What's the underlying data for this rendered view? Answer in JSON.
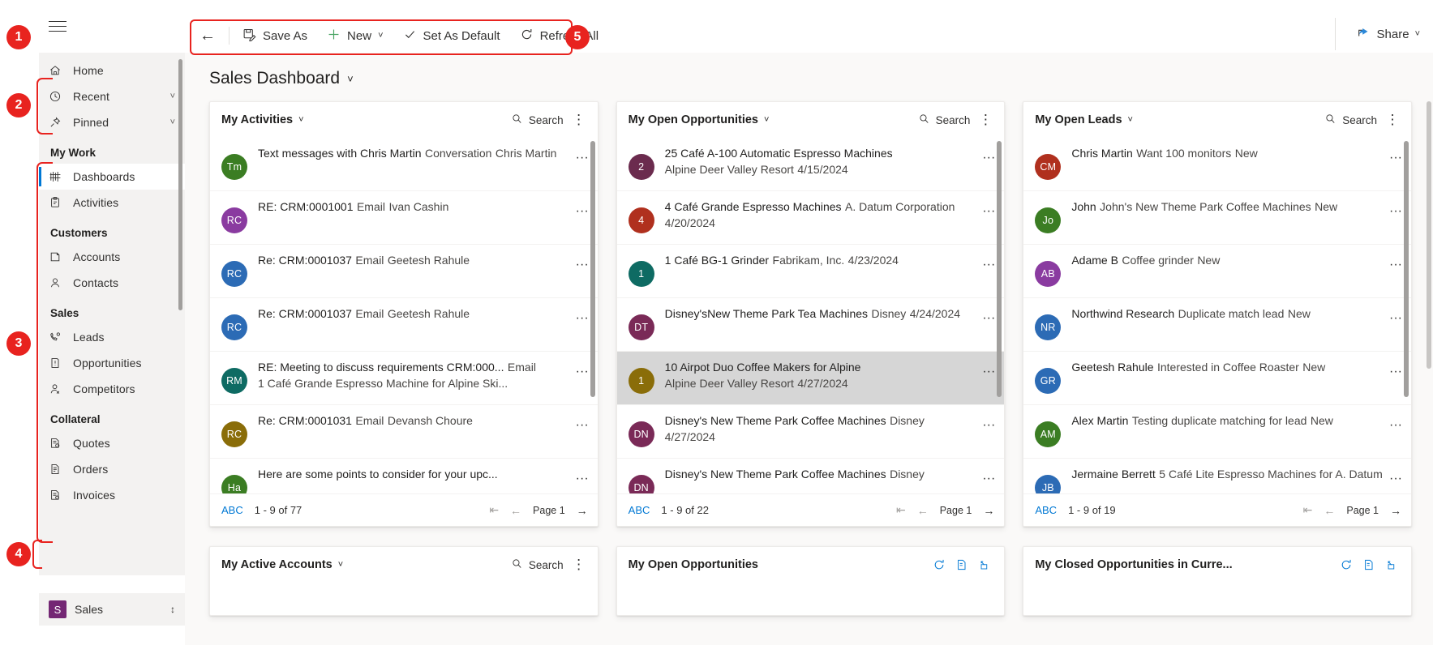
{
  "topbar": {
    "hamburger_label": "Site map",
    "back_label": "Back",
    "buttons": [
      {
        "id": "save-as",
        "label": "Save As",
        "icon": "save-as-icon"
      },
      {
        "id": "new",
        "label": "New",
        "icon": "plus-icon",
        "has_chevron": true
      },
      {
        "id": "set-as-default",
        "label": "Set As Default",
        "icon": "check-icon"
      },
      {
        "id": "refresh-all",
        "label": "Refresh All",
        "icon": "refresh-icon"
      }
    ],
    "share": {
      "label": "Share",
      "icon": "share-icon",
      "has_chevron": true
    }
  },
  "sidebar": {
    "items": [
      {
        "id": "home",
        "label": "Home",
        "icon": "home-icon",
        "expandable": false
      },
      {
        "id": "recent",
        "label": "Recent",
        "icon": "clock-icon",
        "expandable": true
      },
      {
        "id": "pinned",
        "label": "Pinned",
        "icon": "pin-icon",
        "expandable": true
      }
    ],
    "groups": [
      {
        "title": "My Work",
        "items": [
          {
            "id": "dashboards",
            "label": "Dashboards",
            "icon": "dashboard-icon",
            "selected": true
          },
          {
            "id": "activities",
            "label": "Activities",
            "icon": "activities-icon",
            "selected": false
          }
        ]
      },
      {
        "title": "Customers",
        "items": [
          {
            "id": "accounts",
            "label": "Accounts",
            "icon": "accounts-icon",
            "selected": false
          },
          {
            "id": "contacts",
            "label": "Contacts",
            "icon": "contact-icon",
            "selected": false
          }
        ]
      },
      {
        "title": "Sales",
        "items": [
          {
            "id": "leads",
            "label": "Leads",
            "icon": "leads-icon",
            "selected": false
          },
          {
            "id": "opportunities",
            "label": "Opportunities",
            "icon": "opportunity-icon",
            "selected": false
          },
          {
            "id": "competitors",
            "label": "Competitors",
            "icon": "competitor-icon",
            "selected": false
          }
        ]
      },
      {
        "title": "Collateral",
        "items": [
          {
            "id": "quotes",
            "label": "Quotes",
            "icon": "quote-icon",
            "selected": false
          },
          {
            "id": "orders",
            "label": "Orders",
            "icon": "order-icon",
            "selected": false
          },
          {
            "id": "invoices",
            "label": "Invoices",
            "icon": "invoice-icon",
            "selected": false
          }
        ]
      }
    ],
    "app_switcher": {
      "initial": "S",
      "label": "Sales",
      "icon": "updown-chevron-icon"
    }
  },
  "dashboard": {
    "title": "Sales Dashboard",
    "title_chevron": "chevron-down-icon"
  },
  "common": {
    "search_label": "Search",
    "page_label": "Page 1",
    "abc_label": "ABC",
    "more_dots": "···",
    "kebab": "⋮"
  },
  "cards": [
    {
      "id": "my-activities",
      "title": "My Activities",
      "has_chevron": true,
      "search_label": "Search",
      "footer": {
        "abc": "ABC",
        "count": "1 - 9 of 77",
        "page": "Page 1"
      },
      "rows": [
        {
          "initials": "Tm",
          "color": "#3b7d23",
          "l1": "Text messages with Chris Martin",
          "l2": "Conversation",
          "l3": "Chris Martin",
          "selected": false
        },
        {
          "initials": "RC",
          "color": "#8a3ba0",
          "l1": "RE: CRM:0001001",
          "l2": "Email",
          "l3": "Ivan Cashin",
          "selected": false
        },
        {
          "initials": "RC",
          "color": "#2c6bb5",
          "l1": "Re: CRM:0001037",
          "l2": "Email",
          "l3": "Geetesh Rahule",
          "selected": false
        },
        {
          "initials": "RC",
          "color": "#2c6bb5",
          "l1": "Re: CRM:0001037",
          "l2": "Email",
          "l3": "Geetesh Rahule",
          "selected": false
        },
        {
          "initials": "RM",
          "color": "#0e6b63",
          "l1": "RE: Meeting to discuss requirements CRM:000...",
          "l2": "Email",
          "l3": "1 Café Grande Espresso Machine for Alpine Ski...",
          "selected": false
        },
        {
          "initials": "RC",
          "color": "#8a6d09",
          "l1": "Re: CRM:0001031",
          "l2": "Email",
          "l3": "Devansh Choure",
          "selected": false
        },
        {
          "initials": "Ha",
          "color": "#3b7d23",
          "l1": "Here are some points to consider for your upc...",
          "l2": "",
          "l3": "",
          "selected": false
        }
      ]
    },
    {
      "id": "my-open-opportunities",
      "title": "My Open Opportunities",
      "has_chevron": true,
      "search_label": "Search",
      "footer": {
        "abc": "ABC",
        "count": "1 - 9 of 22",
        "page": "Page 1"
      },
      "rows": [
        {
          "initials": "2",
          "color": "#6b2b4e",
          "l1": "25 Café A-100 Automatic Espresso Machines",
          "l2": "Alpine Deer Valley Resort",
          "l3": "4/15/2024",
          "selected": false
        },
        {
          "initials": "4",
          "color": "#b0301e",
          "l1": "4 Café Grande Espresso Machines",
          "l2": "A. Datum Corporation",
          "l3": "4/20/2024",
          "selected": false
        },
        {
          "initials": "1",
          "color": "#0e6b63",
          "l1": "1 Café BG-1 Grinder",
          "l2": "Fabrikam, Inc.",
          "l3": "4/23/2024",
          "selected": false
        },
        {
          "initials": "DT",
          "color": "#7a2a57",
          "l1": "Disney'sNew Theme Park Tea Machines",
          "l2": "Disney",
          "l3": "4/24/2024",
          "selected": false
        },
        {
          "initials": "1",
          "color": "#8a6d09",
          "l1": "10 Airpot Duo Coffee Makers for Alpine",
          "l2": "Alpine Deer Valley Resort",
          "l3": "4/27/2024",
          "selected": true
        },
        {
          "initials": "DN",
          "color": "#7a2a57",
          "l1": "Disney's New Theme Park Coffee Machines",
          "l2": "Disney",
          "l3": "4/27/2024",
          "selected": false
        },
        {
          "initials": "DN",
          "color": "#7a2a57",
          "l1": "Disney's New Theme Park Coffee Machines",
          "l2": "Disney",
          "l3": "",
          "selected": false
        }
      ]
    },
    {
      "id": "my-open-leads",
      "title": "My Open Leads",
      "has_chevron": true,
      "search_label": "Search",
      "footer": {
        "abc": "ABC",
        "count": "1 - 9 of 19",
        "page": "Page 1"
      },
      "rows": [
        {
          "initials": "CM",
          "color": "#b0301e",
          "l1": "Chris Martin",
          "l2": "Want 100 monitors",
          "l3": "New",
          "selected": false
        },
        {
          "initials": "Jo",
          "color": "#3b7d23",
          "l1": "John",
          "l2": "John's New Theme Park Coffee Machines",
          "l3": "New",
          "selected": false
        },
        {
          "initials": "AB",
          "color": "#8a3ba0",
          "l1": "Adame B",
          "l2": "Coffee grinder",
          "l3": "New",
          "selected": false
        },
        {
          "initials": "NR",
          "color": "#2c6bb5",
          "l1": "Northwind Research",
          "l2": "Duplicate match lead",
          "l3": "New",
          "selected": false
        },
        {
          "initials": "GR",
          "color": "#2c6bb5",
          "l1": "Geetesh Rahule",
          "l2": "Interested in Coffee Roaster",
          "l3": "New",
          "selected": false
        },
        {
          "initials": "AM",
          "color": "#3b7d23",
          "l1": "Alex Martin",
          "l2": "Testing duplicate matching for lead",
          "l3": "New",
          "selected": false
        },
        {
          "initials": "JB",
          "color": "#2c6bb5",
          "l1": "Jermaine Berrett",
          "l2": "5 Café Lite Espresso Machines for A. Datum",
          "l3": "",
          "selected": false
        }
      ]
    }
  ],
  "bottom_cards": [
    {
      "id": "my-active-accounts",
      "title": "My Active Accounts",
      "has_chevron": true,
      "search_label": "Search",
      "type": "list"
    },
    {
      "id": "my-open-opportunities-chart",
      "title": "My Open Opportunities",
      "has_chevron": false,
      "type": "chart",
      "icons": [
        "refresh-icon",
        "chart-type-icon",
        "expand-icon"
      ]
    },
    {
      "id": "my-closed-opportunities-chart",
      "title": "My Closed Opportunities in Curre...",
      "has_chevron": false,
      "type": "chart",
      "icons": [
        "refresh-icon",
        "chart-type-icon",
        "expand-icon"
      ]
    }
  ],
  "annotations": [
    {
      "id": "1",
      "label": "1"
    },
    {
      "id": "2",
      "label": "2"
    },
    {
      "id": "3",
      "label": "3"
    },
    {
      "id": "4",
      "label": "4"
    },
    {
      "id": "5",
      "label": "5"
    }
  ]
}
